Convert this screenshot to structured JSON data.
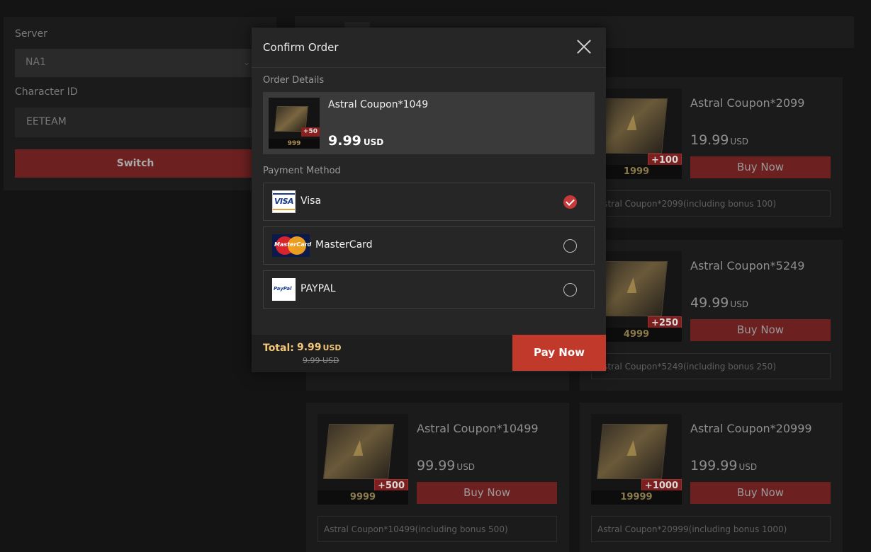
{
  "sidebar": {
    "server_label": "Server",
    "server_value": "NA1",
    "character_label": "Character ID",
    "character_value": "EETEAM",
    "switch_label": "Switch"
  },
  "products": [
    {
      "title": "Astral Coupon*2099",
      "price": "19.99",
      "currency": "USD",
      "buy_label": "Buy Now",
      "bonus": "+100",
      "qty": "1999",
      "description": "Astral Coupon*2099(including bonus 100)"
    },
    {
      "title": "Astral Coupon*5249",
      "price": "49.99",
      "currency": "USD",
      "buy_label": "Buy Now",
      "bonus": "+250",
      "qty": "4999",
      "description": "Astral Coupon*5249(including bonus 250)"
    },
    {
      "title": "Astral Coupon*10499",
      "price": "99.99",
      "currency": "USD",
      "buy_label": "Buy Now",
      "bonus": "+500",
      "qty": "9999",
      "description": "Astral Coupon*10499(including bonus 500)"
    },
    {
      "title": "Astral Coupon*20999",
      "price": "199.99",
      "currency": "USD",
      "buy_label": "Buy Now",
      "bonus": "+1000",
      "qty": "19999",
      "description": "Astral Coupon*20999(including bonus 1000)"
    }
  ],
  "modal": {
    "title": "Confirm Order",
    "order_details_label": "Order Details",
    "order": {
      "name": "Astral Coupon*1049",
      "price": "9.99",
      "currency": "USD",
      "bonus": "+50",
      "qty": "999"
    },
    "payment_method_label": "Payment Method",
    "payment_methods": [
      {
        "label": "Visa",
        "icon": "visa-logo",
        "selected": true
      },
      {
        "label": "MasterCard",
        "icon": "mastercard-logo",
        "selected": false
      },
      {
        "label": "PAYPAL",
        "icon": "paypal-logo",
        "selected": false
      }
    ],
    "total_label": "Total:",
    "total_value": "9.99",
    "total_currency": "USD",
    "original_total": "9.99 USD",
    "pay_now_label": "Pay Now",
    "visa_logo_text": "VISA",
    "mastercard_logo_text": "MasterCard",
    "paypal_logo_text": "PayPal"
  },
  "colors": {
    "accent": "#c0392b",
    "total_text": "#f2c778",
    "background": "#141414",
    "modal_bg": "#262626"
  }
}
